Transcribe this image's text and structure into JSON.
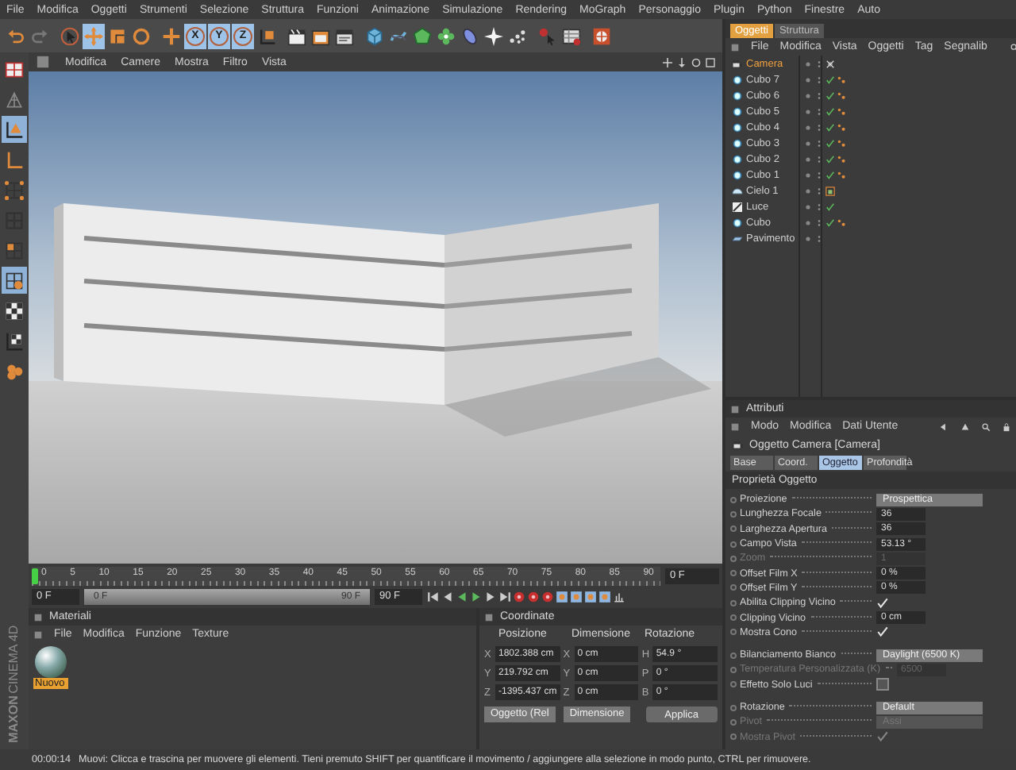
{
  "menu_bar": [
    "File",
    "Modifica",
    "Oggetti",
    "Strumenti",
    "Selezione",
    "Struttura",
    "Funzioni",
    "Animazione",
    "Simulazione",
    "Rendering",
    "MoGraph",
    "Personaggio",
    "Plugin",
    "Python",
    "Finestre",
    "Auto"
  ],
  "toolbar": [
    [
      {
        "kind": "undo",
        "selected": false
      },
      {
        "kind": "redo",
        "selected": false
      }
    ],
    [
      {
        "kind": "select",
        "selected": false
      },
      {
        "kind": "move",
        "selected": true
      },
      {
        "kind": "scale",
        "selected": false
      },
      {
        "kind": "rotate",
        "selected": false
      }
    ],
    [
      {
        "kind": "add",
        "selected": false
      },
      {
        "kind": "axis",
        "label": "X",
        "selected": true
      },
      {
        "kind": "axis",
        "label": "Y",
        "selected": true
      },
      {
        "kind": "axis",
        "label": "Z",
        "selected": true
      },
      {
        "kind": "coords",
        "selected": false
      }
    ],
    [
      {
        "kind": "render_view",
        "selected": false
      },
      {
        "kind": "render_picture",
        "selected": false
      },
      {
        "kind": "render_settings",
        "selected": false
      }
    ],
    [
      {
        "kind": "cube",
        "selected": false
      },
      {
        "kind": "spline",
        "selected": false
      },
      {
        "kind": "nurbs",
        "selected": false
      },
      {
        "kind": "array",
        "selected": false
      },
      {
        "kind": "deformer",
        "selected": false
      },
      {
        "kind": "scene",
        "selected": false
      },
      {
        "kind": "particles",
        "selected": false
      }
    ],
    [
      {
        "kind": "help",
        "selected": false
      },
      {
        "kind": "timeline",
        "selected": false
      }
    ],
    [
      {
        "kind": "render_grid",
        "selected": false
      }
    ]
  ],
  "left_tools": [
    {
      "kind": "layout",
      "selected": false
    },
    {
      "kind": "model",
      "selected": false
    },
    {
      "kind": "object_axis",
      "selected": true
    },
    {
      "kind": "axis_l",
      "selected": false
    },
    {
      "kind": "points",
      "selected": false
    },
    {
      "kind": "edges",
      "selected": false
    },
    {
      "kind": "polygons",
      "selected": false
    },
    {
      "kind": "uv",
      "selected": true
    },
    {
      "kind": "checker",
      "selected": false
    },
    {
      "kind": "checker_axis",
      "selected": false
    },
    {
      "kind": "cluster",
      "selected": false
    }
  ],
  "logo": [
    "MAXON",
    "CINEMA 4D"
  ],
  "viewport": {
    "menu": [
      "Modifica",
      "Camere",
      "Mostra",
      "Filtro",
      "Vista"
    ]
  },
  "timeline": {
    "ruler_labels": [
      "0",
      "5",
      "10",
      "15",
      "20",
      "25",
      "30",
      "35",
      "40",
      "45",
      "50",
      "55",
      "60",
      "65",
      "70",
      "75",
      "80",
      "85",
      "90"
    ],
    "current_frame": "0 F",
    "start_field": "0 F",
    "level": 1,
    "range_start": "0 F",
    "range_end": "90 F",
    "end_field": "90 F"
  },
  "materials": {
    "title": "Materiali",
    "menu": [
      "File",
      "Modifica",
      "Funzione",
      "Texture"
    ],
    "items": [
      {
        "name": "Nuovo",
        "selected": true
      }
    ]
  },
  "coordinates": {
    "title": "Coordinate",
    "columns": [
      "Posizione",
      "Dimensione",
      "Rotazione"
    ],
    "rows": [
      {
        "axis_1": "X",
        "value_1": "1802.388 cm",
        "axis_2": "X",
        "value_2": "0 cm",
        "axis_3": "H",
        "value_3": "54.9 °"
      },
      {
        "axis_1": "Y",
        "value_1": "219.792 cm",
        "axis_2": "Y",
        "value_2": "0 cm",
        "axis_3": "P",
        "value_3": "0 °"
      },
      {
        "axis_1": "Z",
        "value_1": "-1395.437 cm",
        "axis_2": "Z",
        "value_2": "0 cm",
        "axis_3": "B",
        "value_3": "0 °"
      }
    ],
    "mode_dropdown": "Oggetto (Rel",
    "size_dropdown": "Dimensione",
    "apply_button": "Applica"
  },
  "objects": {
    "tabs": [
      {
        "label": "Oggetti",
        "selected": true
      },
      {
        "label": "Struttura",
        "selected": false
      }
    ],
    "menu": [
      "File",
      "Modifica",
      "Vista",
      "Oggetti",
      "Tag",
      "Segnalib"
    ],
    "items": [
      {
        "name": "Camera",
        "kind": "camera",
        "selected": true,
        "checked": false,
        "tags": [
          {
            "kind": "target"
          }
        ]
      },
      {
        "name": "Cubo 7",
        "kind": "cube",
        "selected": false,
        "checked": true,
        "tags": [
          {
            "kind": "material"
          }
        ]
      },
      {
        "name": "Cubo 6",
        "kind": "cube",
        "selected": false,
        "checked": true,
        "tags": [
          {
            "kind": "material"
          }
        ]
      },
      {
        "name": "Cubo 5",
        "kind": "cube",
        "selected": false,
        "checked": true,
        "tags": [
          {
            "kind": "material"
          }
        ]
      },
      {
        "name": "Cubo 4",
        "kind": "cube",
        "selected": false,
        "checked": true,
        "tags": [
          {
            "kind": "material"
          }
        ]
      },
      {
        "name": "Cubo 3",
        "kind": "cube",
        "selected": false,
        "checked": true,
        "tags": [
          {
            "kind": "material"
          }
        ]
      },
      {
        "name": "Cubo 2",
        "kind": "cube",
        "selected": false,
        "checked": true,
        "tags": [
          {
            "kind": "material"
          }
        ]
      },
      {
        "name": "Cubo 1",
        "kind": "cube",
        "selected": false,
        "checked": true,
        "tags": [
          {
            "kind": "material"
          }
        ]
      },
      {
        "name": "Cielo 1",
        "kind": "sky",
        "selected": false,
        "checked": false,
        "tags": [
          {
            "kind": "compositing"
          }
        ]
      },
      {
        "name": "Luce",
        "kind": "light",
        "selected": false,
        "checked": true
      },
      {
        "name": "Cubo",
        "kind": "cube",
        "selected": false,
        "checked": true,
        "tags": [
          {
            "kind": "material"
          }
        ]
      },
      {
        "name": "Pavimento",
        "kind": "floor",
        "selected": false,
        "checked": false
      }
    ]
  },
  "attributes": {
    "title": "Attributi",
    "menu": [
      "Modo",
      "Modifica",
      "Dati Utente"
    ],
    "object_title": "Oggetto Camera [Camera]",
    "tabs": [
      {
        "label": "Base",
        "selected": false
      },
      {
        "label": "Coord.",
        "selected": false
      },
      {
        "label": "Oggetto",
        "selected": true
      },
      {
        "label": "Profondità",
        "selected": false
      }
    ],
    "section": "Proprietà Oggetto",
    "groups": [
      [
        {
          "label": "Proiezione",
          "kind": "dropdown",
          "value": "Prospettica",
          "disabled": false
        },
        {
          "label": "Lunghezza Focale",
          "kind": "number",
          "value": "36",
          "disabled": false
        },
        {
          "label": "Larghezza Apertura",
          "kind": "number",
          "value": "36",
          "disabled": false
        },
        {
          "label": "Campo Vista",
          "kind": "number",
          "value": "53.13 °",
          "disabled": false
        },
        {
          "label": "Zoom",
          "kind": "number",
          "value": "1",
          "disabled": true
        },
        {
          "label": "Offset Film X",
          "kind": "number",
          "value": "0 %",
          "disabled": false
        },
        {
          "label": "Offset Film Y",
          "kind": "number",
          "value": "0 %",
          "disabled": false
        },
        {
          "label": "Abilita Clipping Vicino",
          "kind": "check",
          "checked": true,
          "disabled": false
        },
        {
          "label": "Clipping Vicino",
          "kind": "number",
          "value": "0 cm",
          "disabled": false
        },
        {
          "label": "Mostra Cono",
          "kind": "check",
          "checked": true,
          "disabled": false
        }
      ],
      [
        {
          "label": "Bilanciamento Bianco",
          "kind": "dropdown",
          "value": "Daylight (6500 K)",
          "disabled": false
        },
        {
          "label": "Temperatura Personalizzata (K)",
          "kind": "number",
          "value": "6500",
          "disabled": true
        },
        {
          "label": "Effetto Solo Luci",
          "kind": "check",
          "checked": false,
          "disabled": false
        }
      ],
      [
        {
          "label": "Rotazione",
          "kind": "dropdown",
          "value": "Default",
          "disabled": false
        },
        {
          "label": "Pivot",
          "kind": "dropdown",
          "value": "Assi",
          "disabled": true
        },
        {
          "label": "Mostra Pivot",
          "kind": "check",
          "checked": true,
          "disabled": true
        }
      ]
    ]
  },
  "status_bar": {
    "time": "00:00:14",
    "message": "Muovi: Clicca e trascina per muovere gli elementi. Tieni premuto SHIFT per quantificare il movimento / aggiungere alla selezione in modo punto, CTRL per rimuovere."
  }
}
